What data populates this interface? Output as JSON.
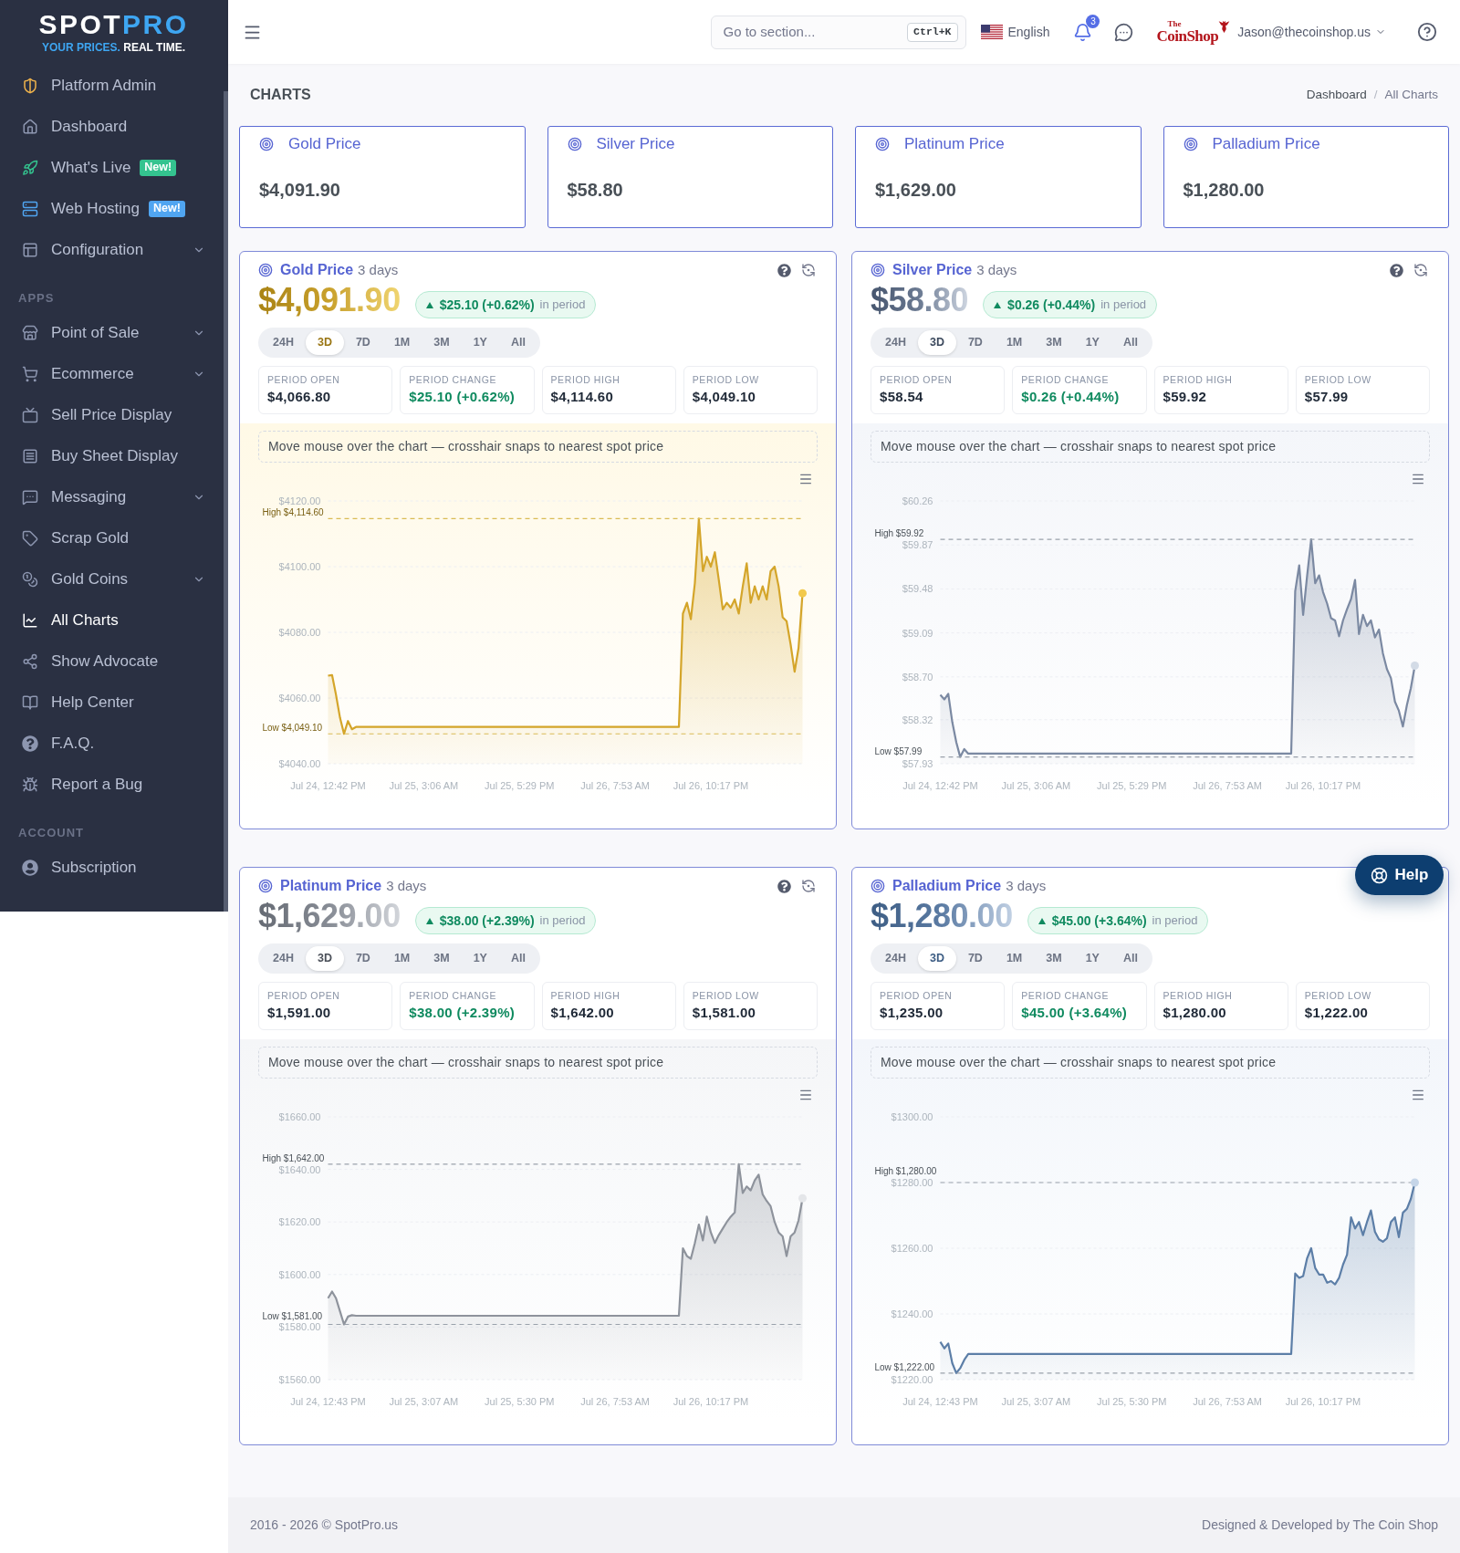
{
  "sidebar": {
    "logo": {
      "word_1": "SPOT",
      "word_2": "PRO",
      "tagline_1": "YOUR PRICES.",
      "tagline_2": "REAL TIME."
    },
    "sections": [
      {
        "items": [
          {
            "label": "Platform Admin",
            "selected": false
          },
          {
            "label": "Dashboard",
            "selected": false
          },
          {
            "label": "What's Live",
            "selected": false,
            "badge": {
              "text": "New!",
              "color": "#34c38f"
            }
          },
          {
            "label": "Web Hosting",
            "selected": false,
            "badge": {
              "text": "New!",
              "color": "#50a5f1"
            }
          },
          {
            "label": "Configuration",
            "selected": false,
            "expanded": false
          }
        ]
      },
      {
        "heading": "APPS",
        "items": [
          {
            "label": "Point of Sale",
            "selected": false,
            "expanded": false
          },
          {
            "label": "Ecommerce",
            "selected": false,
            "expanded": false
          },
          {
            "label": "Sell Price Display",
            "selected": false
          },
          {
            "label": "Buy Sheet Display",
            "selected": false
          },
          {
            "label": "Messaging",
            "selected": false,
            "expanded": false
          },
          {
            "label": "Scrap Gold",
            "selected": false
          },
          {
            "label": "Gold Coins",
            "selected": false,
            "expanded": false
          },
          {
            "label": "All Charts",
            "selected": true
          },
          {
            "label": "Show Advocate",
            "selected": false
          },
          {
            "label": "Help Center",
            "selected": false
          },
          {
            "label": "F.A.Q.",
            "selected": false
          },
          {
            "label": "Report a Bug",
            "selected": false
          }
        ]
      },
      {
        "heading": "ACCOUNT",
        "items": [
          {
            "label": "Subscription",
            "selected": false
          }
        ]
      }
    ]
  },
  "header": {
    "search": {
      "placeholder": "Go to section...",
      "shortcut": "Ctrl+K"
    },
    "language": "English",
    "notifications": "3",
    "brand": {
      "small": "The",
      "name": "CoinShop"
    },
    "user": "Jason@thecoinshop.us"
  },
  "page": {
    "title": "CHARTS",
    "breadcrumb": {
      "separator": "/",
      "items": [
        {
          "label": "Dashboard",
          "selected": false
        },
        {
          "label": "All Charts",
          "selected": true
        }
      ]
    }
  },
  "price_cards": [
    {
      "title": "Gold Price",
      "value": "$4,091.90"
    },
    {
      "title": "Silver Price",
      "value": "$58.80"
    },
    {
      "title": "Platinum Price",
      "value": "$1,629.00"
    },
    {
      "title": "Palladium Price",
      "value": "$1,280.00"
    }
  ],
  "charts": [
    {
      "kind": "gold",
      "title": "Gold Price",
      "period": "3 days",
      "tools_visible": true,
      "price": "$4,091.90",
      "change": {
        "rising": true,
        "text": "$25.10 (+0.62%)",
        "suffix": "in period"
      },
      "ranges": [
        {
          "label": "24H",
          "selected": false
        },
        {
          "label": "3D",
          "selected": true
        },
        {
          "label": "7D",
          "selected": false
        },
        {
          "label": "1M",
          "selected": false
        },
        {
          "label": "3M",
          "selected": false
        },
        {
          "label": "1Y",
          "selected": false
        },
        {
          "label": "All",
          "selected": false
        }
      ],
      "stats": [
        {
          "kind": "plain",
          "label": "PERIOD OPEN",
          "value": "$4,066.80"
        },
        {
          "kind": "change",
          "label": "PERIOD CHANGE",
          "value": "$25.10 (+0.62%)"
        },
        {
          "kind": "plain",
          "label": "PERIOD HIGH",
          "value": "$4,114.60"
        },
        {
          "kind": "plain",
          "label": "PERIOD LOW",
          "value": "$4,049.10"
        }
      ],
      "hint": "Move mouse over the chart — crosshair snaps to nearest spot price",
      "chart_data": {
        "type": "area",
        "grid": true,
        "categories": [
          "Jul 24, 12:42 PM",
          null,
          null,
          null,
          null,
          null,
          null,
          null,
          null,
          null,
          null,
          null,
          null,
          null,
          null,
          null,
          null,
          null,
          null,
          null,
          null,
          null,
          null,
          null,
          "Jul 25, 3:06 AM",
          null,
          null,
          null,
          null,
          null,
          null,
          null,
          null,
          null,
          null,
          null,
          null,
          null,
          null,
          null,
          null,
          null,
          null,
          null,
          null,
          null,
          null,
          null,
          "Jul 25, 5:29 PM",
          null,
          null,
          null,
          null,
          null,
          null,
          null,
          null,
          null,
          null,
          null,
          null,
          null,
          null,
          null,
          null,
          null,
          null,
          null,
          null,
          null,
          null,
          null,
          "Jul 26, 7:53 AM",
          null,
          null,
          null,
          null,
          null,
          null,
          null,
          null,
          null,
          null,
          null,
          null,
          null,
          null,
          null,
          null,
          null,
          null,
          null,
          null,
          null,
          null,
          null,
          "Jul 26, 10:17 PM",
          null,
          null,
          null,
          null,
          null,
          null,
          null,
          null,
          null,
          null,
          null,
          null,
          null,
          null,
          null,
          null,
          null,
          null,
          null,
          null,
          null,
          null,
          null
        ],
        "values": [
          4066.8,
          4067,
          4061,
          4054,
          4049.1,
          4053,
          4050.5,
          4051.2,
          4051.2,
          4051.2,
          4051.2,
          4051.2,
          4051.2,
          4051.2,
          4051.2,
          4051.2,
          4051.2,
          4051.2,
          4051.2,
          4051.2,
          4051.2,
          4051.2,
          4051.2,
          4051.2,
          4051.2,
          4051.2,
          4051.2,
          4051.2,
          4051.2,
          4051.2,
          4051.2,
          4051.2,
          4051.2,
          4051.2,
          4051.2,
          4051.2,
          4051.2,
          4051.2,
          4051.2,
          4051.2,
          4051.2,
          4051.2,
          4051.2,
          4051.2,
          4051.2,
          4051.2,
          4051.2,
          4051.2,
          4051.2,
          4051.2,
          4051.2,
          4051.2,
          4051.2,
          4051.2,
          4051.2,
          4051.2,
          4051.2,
          4051.2,
          4051.2,
          4051.2,
          4051.2,
          4051.2,
          4051.2,
          4051.2,
          4051.2,
          4051.2,
          4051.2,
          4051.2,
          4051.2,
          4051.2,
          4051.2,
          4051.2,
          4051.2,
          4051.2,
          4051.2,
          4051.2,
          4051.2,
          4051.2,
          4051.2,
          4051.2,
          4051.2,
          4051.2,
          4051.2,
          4051.2,
          4051.2,
          4051.2,
          4051.2,
          4051.2,
          4051.2,
          4085.7,
          4089,
          4084,
          4095,
          4114.6,
          4098.6,
          4103,
          4100,
          4104.4,
          4096,
          4087,
          4089,
          4087.5,
          4090,
          4085.7,
          4094,
          4101,
          4089,
          4094,
          4090,
          4094,
          4090,
          4098.6,
          4100,
          4094,
          4084.6,
          4083.4,
          4076.4,
          4068,
          4075.2,
          4091.9
        ],
        "ylim": [
          4040,
          4120
        ],
        "yticks": [
          {
            "value": 4040,
            "label": "$4040.00"
          },
          {
            "value": 4060,
            "label": "$4060.00"
          },
          {
            "value": 4080,
            "label": "$4080.00"
          },
          {
            "value": 4100,
            "label": "$4100.00"
          },
          {
            "value": 4120,
            "label": "$4120.00"
          }
        ],
        "ref_lines": [
          {
            "axis": "y",
            "value": 4114.6,
            "label": "High $4,114.60"
          },
          {
            "axis": "y",
            "value": 4049.1,
            "label": "Low $4,049.10"
          }
        ]
      }
    },
    {
      "kind": "silver",
      "title": "Silver Price",
      "period": "3 days",
      "tools_visible": true,
      "price": "$58.80",
      "change": {
        "rising": true,
        "text": "$0.26 (+0.44%)",
        "suffix": "in period"
      },
      "ranges": [
        {
          "label": "24H",
          "selected": false
        },
        {
          "label": "3D",
          "selected": true
        },
        {
          "label": "7D",
          "selected": false
        },
        {
          "label": "1M",
          "selected": false
        },
        {
          "label": "3M",
          "selected": false
        },
        {
          "label": "1Y",
          "selected": false
        },
        {
          "label": "All",
          "selected": false
        }
      ],
      "stats": [
        {
          "kind": "plain",
          "label": "PERIOD OPEN",
          "value": "$58.54"
        },
        {
          "kind": "change",
          "label": "PERIOD CHANGE",
          "value": "$0.26 (+0.44%)"
        },
        {
          "kind": "plain",
          "label": "PERIOD HIGH",
          "value": "$59.92"
        },
        {
          "kind": "plain",
          "label": "PERIOD LOW",
          "value": "$57.99"
        }
      ],
      "hint": "Move mouse over the chart — crosshair snaps to nearest spot price",
      "chart_data": {
        "type": "area",
        "grid": true,
        "categories": [
          "Jul 24, 12:42 PM",
          null,
          null,
          null,
          null,
          null,
          null,
          null,
          null,
          null,
          null,
          null,
          null,
          null,
          null,
          null,
          null,
          null,
          null,
          null,
          null,
          null,
          null,
          null,
          "Jul 25, 3:06 AM",
          null,
          null,
          null,
          null,
          null,
          null,
          null,
          null,
          null,
          null,
          null,
          null,
          null,
          null,
          null,
          null,
          null,
          null,
          null,
          null,
          null,
          null,
          null,
          "Jul 25, 5:29 PM",
          null,
          null,
          null,
          null,
          null,
          null,
          null,
          null,
          null,
          null,
          null,
          null,
          null,
          null,
          null,
          null,
          null,
          null,
          null,
          null,
          null,
          null,
          null,
          "Jul 26, 7:53 AM",
          null,
          null,
          null,
          null,
          null,
          null,
          null,
          null,
          null,
          null,
          null,
          null,
          null,
          null,
          null,
          null,
          null,
          null,
          null,
          null,
          null,
          null,
          null,
          "Jul 26, 10:17 PM",
          null,
          null,
          null,
          null,
          null,
          null,
          null,
          null,
          null,
          null,
          null,
          null,
          null,
          null,
          null,
          null,
          null,
          null,
          null,
          null,
          null,
          null,
          null
        ],
        "values": [
          58.54,
          58.5,
          58.55,
          58.3,
          58.12,
          57.99,
          58.06,
          58.02,
          58.02,
          58.02,
          58.02,
          58.02,
          58.02,
          58.02,
          58.02,
          58.02,
          58.02,
          58.02,
          58.02,
          58.02,
          58.02,
          58.02,
          58.02,
          58.02,
          58.02,
          58.02,
          58.02,
          58.02,
          58.02,
          58.02,
          58.02,
          58.02,
          58.02,
          58.02,
          58.02,
          58.02,
          58.02,
          58.02,
          58.02,
          58.02,
          58.02,
          58.02,
          58.02,
          58.02,
          58.02,
          58.02,
          58.02,
          58.02,
          58.02,
          58.02,
          58.02,
          58.02,
          58.02,
          58.02,
          58.02,
          58.02,
          58.02,
          58.02,
          58.02,
          58.02,
          58.02,
          58.02,
          58.02,
          58.02,
          58.02,
          58.02,
          58.02,
          58.02,
          58.02,
          58.02,
          58.02,
          58.02,
          58.02,
          58.02,
          58.02,
          58.02,
          58.02,
          58.02,
          58.02,
          58.02,
          58.02,
          58.02,
          58.02,
          58.02,
          58.02,
          58.02,
          58.02,
          58.02,
          58.02,
          59.46,
          59.69,
          59.25,
          59.6,
          59.92,
          59.53,
          59.6,
          59.45,
          59.35,
          59.22,
          59.2,
          59.06,
          59.2,
          59.3,
          59.39,
          59.56,
          59.08,
          59.25,
          59.15,
          59.2,
          59.05,
          59.12,
          58.91,
          58.77,
          58.69,
          58.48,
          58.4,
          58.26,
          58.45,
          58.6,
          58.8
        ],
        "ylim": [
          57.93,
          60.26
        ],
        "yticks": [
          {
            "value": 57.93,
            "label": "$57.93"
          },
          {
            "value": 58.32,
            "label": "$58.32"
          },
          {
            "value": 58.7,
            "label": "$58.70"
          },
          {
            "value": 59.09,
            "label": "$59.09"
          },
          {
            "value": 59.48,
            "label": "$59.48"
          },
          {
            "value": 59.87,
            "label": "$59.87"
          },
          {
            "value": 60.26,
            "label": "$60.26"
          }
        ],
        "ref_lines": [
          {
            "axis": "y",
            "value": 59.92,
            "label": "High $59.92"
          },
          {
            "axis": "y",
            "value": 57.99,
            "label": "Low $57.99"
          }
        ]
      }
    },
    {
      "kind": "platinum",
      "title": "Platinum Price",
      "period": "3 days",
      "tools_visible": true,
      "price": "$1,629.00",
      "change": {
        "rising": true,
        "text": "$38.00 (+2.39%)",
        "suffix": "in period"
      },
      "ranges": [
        {
          "label": "24H",
          "selected": false
        },
        {
          "label": "3D",
          "selected": true
        },
        {
          "label": "7D",
          "selected": false
        },
        {
          "label": "1M",
          "selected": false
        },
        {
          "label": "3M",
          "selected": false
        },
        {
          "label": "1Y",
          "selected": false
        },
        {
          "label": "All",
          "selected": false
        }
      ],
      "stats": [
        {
          "kind": "plain",
          "label": "PERIOD OPEN",
          "value": "$1,591.00"
        },
        {
          "kind": "change",
          "label": "PERIOD CHANGE",
          "value": "$38.00 (+2.39%)"
        },
        {
          "kind": "plain",
          "label": "PERIOD HIGH",
          "value": "$1,642.00"
        },
        {
          "kind": "plain",
          "label": "PERIOD LOW",
          "value": "$1,581.00"
        }
      ],
      "hint": "Move mouse over the chart — crosshair snaps to nearest spot price",
      "chart_data": {
        "type": "area",
        "grid": true,
        "categories": [
          "Jul 24, 12:43 PM",
          null,
          null,
          null,
          null,
          null,
          null,
          null,
          null,
          null,
          null,
          null,
          null,
          null,
          null,
          null,
          null,
          null,
          null,
          null,
          null,
          null,
          null,
          null,
          "Jul 25, 3:07 AM",
          null,
          null,
          null,
          null,
          null,
          null,
          null,
          null,
          null,
          null,
          null,
          null,
          null,
          null,
          null,
          null,
          null,
          null,
          null,
          null,
          null,
          null,
          null,
          "Jul 25, 5:30 PM",
          null,
          null,
          null,
          null,
          null,
          null,
          null,
          null,
          null,
          null,
          null,
          null,
          null,
          null,
          null,
          null,
          null,
          null,
          null,
          null,
          null,
          null,
          null,
          "Jul 26, 7:53 AM",
          null,
          null,
          null,
          null,
          null,
          null,
          null,
          null,
          null,
          null,
          null,
          null,
          null,
          null,
          null,
          null,
          null,
          null,
          null,
          null,
          null,
          null,
          null,
          "Jul 26, 10:17 PM",
          null,
          null,
          null,
          null,
          null,
          null,
          null,
          null,
          null,
          null,
          null,
          null,
          null,
          null,
          null,
          null,
          null,
          null,
          null,
          null,
          null,
          null,
          null
        ],
        "values": [
          1591,
          1593.5,
          1591,
          1586,
          1581,
          1584,
          1584.5,
          1584.3,
          1584.3,
          1584.3,
          1584.3,
          1584.3,
          1584.3,
          1584.3,
          1584.3,
          1584.3,
          1584.3,
          1584.3,
          1584.3,
          1584.3,
          1584.3,
          1584.3,
          1584.3,
          1584.3,
          1584.3,
          1584.3,
          1584.3,
          1584.3,
          1584.3,
          1584.3,
          1584.3,
          1584.3,
          1584.3,
          1584.3,
          1584.3,
          1584.3,
          1584.3,
          1584.3,
          1584.3,
          1584.3,
          1584.3,
          1584.3,
          1584.3,
          1584.3,
          1584.3,
          1584.3,
          1584.3,
          1584.3,
          1584.3,
          1584.3,
          1584.3,
          1584.3,
          1584.3,
          1584.3,
          1584.3,
          1584.3,
          1584.3,
          1584.3,
          1584.3,
          1584.3,
          1584.3,
          1584.3,
          1584.3,
          1584.3,
          1584.3,
          1584.3,
          1584.3,
          1584.3,
          1584.3,
          1584.3,
          1584.3,
          1584.3,
          1584.3,
          1584.3,
          1584.3,
          1584.3,
          1584.3,
          1584.3,
          1584.3,
          1584.3,
          1584.3,
          1584.3,
          1584.3,
          1584.3,
          1584.3,
          1584.3,
          1584.3,
          1584.3,
          1584.3,
          1610,
          1607,
          1606,
          1612,
          1619,
          1613,
          1622,
          1616,
          1612,
          1615,
          1617.5,
          1620,
          1622,
          1623.6,
          1642,
          1631,
          1633.5,
          1632,
          1635.8,
          1638,
          1630.5,
          1628,
          1626,
          1620,
          1616,
          1614.5,
          1607,
          1614.5,
          1616,
          1620.6,
          1629
        ],
        "ylim": [
          1560,
          1660
        ],
        "yticks": [
          {
            "value": 1560,
            "label": "$1560.00"
          },
          {
            "value": 1580,
            "label": "$1580.00"
          },
          {
            "value": 1600,
            "label": "$1600.00"
          },
          {
            "value": 1620,
            "label": "$1620.00"
          },
          {
            "value": 1640,
            "label": "$1640.00"
          },
          {
            "value": 1660,
            "label": "$1660.00"
          }
        ],
        "ref_lines": [
          {
            "axis": "y",
            "value": 1642,
            "label": "High $1,642.00"
          },
          {
            "axis": "y",
            "value": 1581,
            "label": "Low $1,581.00"
          }
        ]
      }
    },
    {
      "kind": "palladium",
      "title": "Palladium Price",
      "period": "3 days",
      "tools_visible": false,
      "price": "$1,280.00",
      "change": {
        "rising": true,
        "text": "$45.00 (+3.64%)",
        "suffix": "in period"
      },
      "ranges": [
        {
          "label": "24H",
          "selected": false
        },
        {
          "label": "3D",
          "selected": true
        },
        {
          "label": "7D",
          "selected": false
        },
        {
          "label": "1M",
          "selected": false
        },
        {
          "label": "3M",
          "selected": false
        },
        {
          "label": "1Y",
          "selected": false
        },
        {
          "label": "All",
          "selected": false
        }
      ],
      "stats": [
        {
          "kind": "plain",
          "label": "PERIOD OPEN",
          "value": "$1,235.00"
        },
        {
          "kind": "change",
          "label": "PERIOD CHANGE",
          "value": "$45.00 (+3.64%)"
        },
        {
          "kind": "plain",
          "label": "PERIOD HIGH",
          "value": "$1,280.00"
        },
        {
          "kind": "plain",
          "label": "PERIOD LOW",
          "value": "$1,222.00"
        }
      ],
      "hint": "Move mouse over the chart — crosshair snaps to nearest spot price",
      "chart_data": {
        "type": "area",
        "grid": true,
        "categories": [
          "Jul 24, 12:43 PM",
          null,
          null,
          null,
          null,
          null,
          null,
          null,
          null,
          null,
          null,
          null,
          null,
          null,
          null,
          null,
          null,
          null,
          null,
          null,
          null,
          null,
          null,
          null,
          "Jul 25, 3:07 AM",
          null,
          null,
          null,
          null,
          null,
          null,
          null,
          null,
          null,
          null,
          null,
          null,
          null,
          null,
          null,
          null,
          null,
          null,
          null,
          null,
          null,
          null,
          null,
          "Jul 25, 5:30 PM",
          null,
          null,
          null,
          null,
          null,
          null,
          null,
          null,
          null,
          null,
          null,
          null,
          null,
          null,
          null,
          null,
          null,
          null,
          null,
          null,
          null,
          null,
          null,
          "Jul 26, 7:53 AM",
          null,
          null,
          null,
          null,
          null,
          null,
          null,
          null,
          null,
          null,
          null,
          null,
          null,
          null,
          null,
          null,
          null,
          null,
          null,
          null,
          null,
          null,
          null,
          "Jul 26, 10:17 PM",
          null,
          null,
          null,
          null,
          null,
          null,
          null,
          null,
          null,
          null,
          null,
          null,
          null,
          null,
          null,
          null,
          null,
          null,
          null,
          null,
          null,
          null,
          null
        ],
        "values": [
          1231.5,
          1229.5,
          1231,
          1225,
          1222,
          1223.5,
          1226,
          1227.8,
          1227.8,
          1227.8,
          1227.8,
          1227.8,
          1227.8,
          1227.8,
          1227.8,
          1227.8,
          1227.8,
          1227.8,
          1227.8,
          1227.8,
          1227.8,
          1227.8,
          1227.8,
          1227.8,
          1227.8,
          1227.8,
          1227.8,
          1227.8,
          1227.8,
          1227.8,
          1227.8,
          1227.8,
          1227.8,
          1227.8,
          1227.8,
          1227.8,
          1227.8,
          1227.8,
          1227.8,
          1227.8,
          1227.8,
          1227.8,
          1227.8,
          1227.8,
          1227.8,
          1227.8,
          1227.8,
          1227.8,
          1227.8,
          1227.8,
          1227.8,
          1227.8,
          1227.8,
          1227.8,
          1227.8,
          1227.8,
          1227.8,
          1227.8,
          1227.8,
          1227.8,
          1227.8,
          1227.8,
          1227.8,
          1227.8,
          1227.8,
          1227.8,
          1227.8,
          1227.8,
          1227.8,
          1227.8,
          1227.8,
          1227.8,
          1227.8,
          1227.8,
          1227.8,
          1227.8,
          1227.8,
          1227.8,
          1227.8,
          1227.8,
          1227.8,
          1227.8,
          1227.8,
          1227.8,
          1227.8,
          1227.8,
          1227.8,
          1227.8,
          1227.8,
          1252.3,
          1251,
          1251.5,
          1257,
          1260,
          1254,
          1252,
          1252,
          1249.5,
          1250,
          1249,
          1251,
          1255,
          1258,
          1269.4,
          1266,
          1268,
          1264,
          1268,
          1271.5,
          1265,
          1262.7,
          1262,
          1263,
          1268,
          1269.4,
          1263.4,
          1270.8,
          1272,
          1275,
          1280
        ],
        "ylim": [
          1220,
          1300
        ],
        "yticks": [
          {
            "value": 1220,
            "label": "$1220.00"
          },
          {
            "value": 1240,
            "label": "$1240.00"
          },
          {
            "value": 1260,
            "label": "$1260.00"
          },
          {
            "value": 1280,
            "label": "$1280.00"
          },
          {
            "value": 1300,
            "label": "$1300.00"
          }
        ],
        "ref_lines": [
          {
            "axis": "y",
            "value": 1280,
            "label": "High $1,280.00"
          },
          {
            "axis": "y",
            "value": 1222,
            "label": "Low $1,222.00"
          }
        ]
      }
    }
  ],
  "help_button": {
    "label": "Help"
  },
  "footer": {
    "left": "2016 - 2026 © SpotPro.us",
    "right": "Designed & Developed by The Coin Shop"
  }
}
